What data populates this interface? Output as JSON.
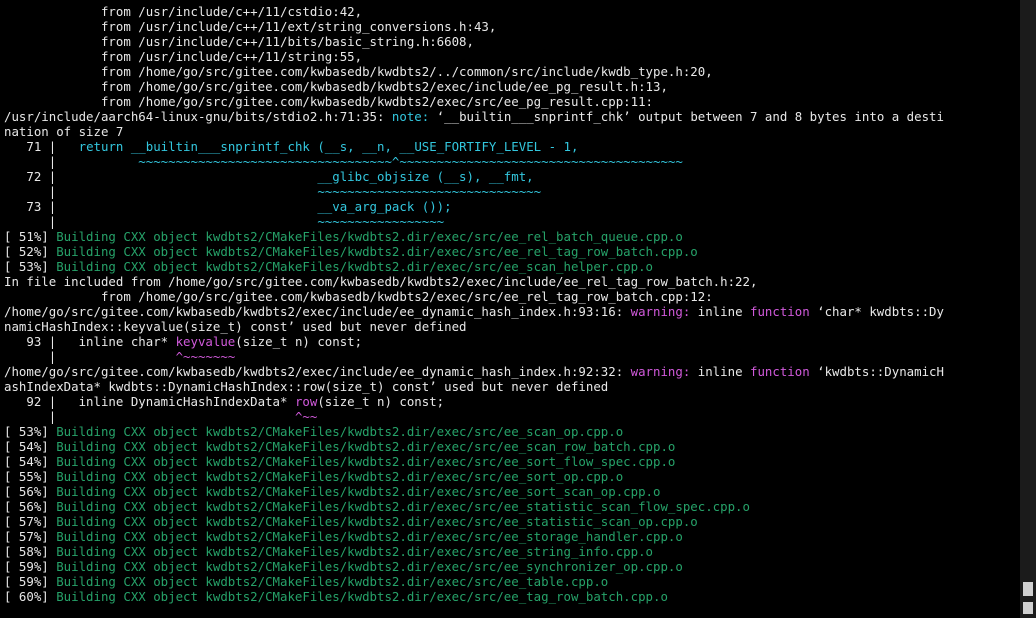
{
  "colors": {
    "green": "#26a269",
    "cyan": "#33c7de",
    "magenta": "#d15adb",
    "white": "#e8e8e8"
  },
  "lines": [
    [
      [
        "w",
        "             from /usr/include/c++/11/cstdio:42,"
      ]
    ],
    [
      [
        "w",
        "             from /usr/include/c++/11/ext/string_conversions.h:43,"
      ]
    ],
    [
      [
        "w",
        "             from /usr/include/c++/11/bits/basic_string.h:6608,"
      ]
    ],
    [
      [
        "w",
        "             from /usr/include/c++/11/string:55,"
      ]
    ],
    [
      [
        "w",
        "             from /home/go/src/gitee.com/kwbasedb/kwdbts2/../common/src/include/kwdb_type.h:20,"
      ]
    ],
    [
      [
        "w",
        "             from /home/go/src/gitee.com/kwbasedb/kwdbts2/exec/include/ee_pg_result.h:13,"
      ]
    ],
    [
      [
        "w",
        "             from /home/go/src/gitee.com/kwbasedb/kwdbts2/exec/src/ee_pg_result.cpp:11:"
      ]
    ],
    [
      [
        "w",
        "/usr/include/aarch64-linux-gnu/bits/stdio2.h:71:35: "
      ],
      [
        "c",
        "note: "
      ],
      [
        "w",
        "‘__builtin___snprintf_chk’ output between 7 and 8 bytes into a desti"
      ]
    ],
    [
      [
        "w",
        "nation of size 7"
      ]
    ],
    [
      [
        "w",
        "   71 |   "
      ],
      [
        "c",
        "return"
      ],
      [
        "w",
        " "
      ],
      [
        "c",
        "__builtin___snprintf_chk (__s, __n, __USE_FORTIFY_LEVEL - 1,"
      ]
    ],
    [
      [
        "w",
        "      |           "
      ],
      [
        "c",
        "~~~~~~~~~~~~~~~~~~~~~~~~~~~~~~~~~~^~~~~~~~~~~~~~~~~~~~~~~~~~~~~~~~~~~~~~~"
      ]
    ],
    [
      [
        "w",
        "   72 |                                   "
      ],
      [
        "c",
        "__glibc_objsize (__s), __fmt,"
      ]
    ],
    [
      [
        "w",
        "      |                                   "
      ],
      [
        "c",
        "~~~~~~~~~~~~~~~~~~~~~~~~~~~~~~"
      ]
    ],
    [
      [
        "w",
        "   73 |                                   "
      ],
      [
        "c",
        "__va_arg_pack ());"
      ]
    ],
    [
      [
        "w",
        "      |                                   "
      ],
      [
        "c",
        "~~~~~~~~~~~~~~~~~"
      ]
    ],
    [
      [
        "w",
        "[ 51%] "
      ],
      [
        "g",
        "Building CXX object kwdbts2/CMakeFiles/kwdbts2.dir/exec/src/ee_rel_batch_queue.cpp.o"
      ]
    ],
    [
      [
        "w",
        "[ 52%] "
      ],
      [
        "g",
        "Building CXX object kwdbts2/CMakeFiles/kwdbts2.dir/exec/src/ee_rel_tag_row_batch.cpp.o"
      ]
    ],
    [
      [
        "w",
        "[ 53%] "
      ],
      [
        "g",
        "Building CXX object kwdbts2/CMakeFiles/kwdbts2.dir/exec/src/ee_scan_helper.cpp.o"
      ]
    ],
    [
      [
        "w",
        "In file included from /home/go/src/gitee.com/kwbasedb/kwdbts2/exec/include/ee_rel_tag_row_batch.h:22,"
      ]
    ],
    [
      [
        "w",
        "             from /home/go/src/gitee.com/kwbasedb/kwdbts2/exec/src/ee_rel_tag_row_batch.cpp:12:"
      ]
    ],
    [
      [
        "w",
        "/home/go/src/gitee.com/kwbasedb/kwdbts2/exec/include/ee_dynamic_hash_index.h:93:16: "
      ],
      [
        "m",
        "warning: "
      ],
      [
        "w",
        "inline "
      ],
      [
        "m",
        "function"
      ],
      [
        "w",
        " ‘char* kwdbts::Dy"
      ]
    ],
    [
      [
        "w",
        "namicHashIndex::keyvalue(size_t) const’ used but never defined"
      ]
    ],
    [
      [
        "w",
        "   93 |   inline char* "
      ],
      [
        "m",
        "keyvalue"
      ],
      [
        "w",
        "(size_t n) const;"
      ]
    ],
    [
      [
        "w",
        "      |                "
      ],
      [
        "m",
        "^~~~~~~~"
      ]
    ],
    [
      [
        "w",
        "/home/go/src/gitee.com/kwbasedb/kwdbts2/exec/include/ee_dynamic_hash_index.h:92:32: "
      ],
      [
        "m",
        "warning: "
      ],
      [
        "w",
        "inline "
      ],
      [
        "m",
        "function"
      ],
      [
        "w",
        " ‘kwdbts::DynamicH"
      ]
    ],
    [
      [
        "w",
        "ashIndexData* kwdbts::DynamicHashIndex::row(size_t) const’ used but never defined"
      ]
    ],
    [
      [
        "w",
        "   92 |   inline DynamicHashIndexData* "
      ],
      [
        "m",
        "row"
      ],
      [
        "w",
        "(size_t n) const;"
      ]
    ],
    [
      [
        "w",
        "      |                                "
      ],
      [
        "m",
        "^~~"
      ]
    ],
    [
      [
        "w",
        "[ 53%] "
      ],
      [
        "g",
        "Building CXX object kwdbts2/CMakeFiles/kwdbts2.dir/exec/src/ee_scan_op.cpp.o"
      ]
    ],
    [
      [
        "w",
        "[ 54%] "
      ],
      [
        "g",
        "Building CXX object kwdbts2/CMakeFiles/kwdbts2.dir/exec/src/ee_scan_row_batch.cpp.o"
      ]
    ],
    [
      [
        "w",
        "[ 54%] "
      ],
      [
        "g",
        "Building CXX object kwdbts2/CMakeFiles/kwdbts2.dir/exec/src/ee_sort_flow_spec.cpp.o"
      ]
    ],
    [
      [
        "w",
        "[ 55%] "
      ],
      [
        "g",
        "Building CXX object kwdbts2/CMakeFiles/kwdbts2.dir/exec/src/ee_sort_op.cpp.o"
      ]
    ],
    [
      [
        "w",
        "[ 56%] "
      ],
      [
        "g",
        "Building CXX object kwdbts2/CMakeFiles/kwdbts2.dir/exec/src/ee_sort_scan_op.cpp.o"
      ]
    ],
    [
      [
        "w",
        "[ 56%] "
      ],
      [
        "g",
        "Building CXX object kwdbts2/CMakeFiles/kwdbts2.dir/exec/src/ee_statistic_scan_flow_spec.cpp.o"
      ]
    ],
    [
      [
        "w",
        "[ 57%] "
      ],
      [
        "g",
        "Building CXX object kwdbts2/CMakeFiles/kwdbts2.dir/exec/src/ee_statistic_scan_op.cpp.o"
      ]
    ],
    [
      [
        "w",
        "[ 57%] "
      ],
      [
        "g",
        "Building CXX object kwdbts2/CMakeFiles/kwdbts2.dir/exec/src/ee_storage_handler.cpp.o"
      ]
    ],
    [
      [
        "w",
        "[ 58%] "
      ],
      [
        "g",
        "Building CXX object kwdbts2/CMakeFiles/kwdbts2.dir/exec/src/ee_string_info.cpp.o"
      ]
    ],
    [
      [
        "w",
        "[ 59%] "
      ],
      [
        "g",
        "Building CXX object kwdbts2/CMakeFiles/kwdbts2.dir/exec/src/ee_synchronizer_op.cpp.o"
      ]
    ],
    [
      [
        "w",
        "[ 59%] "
      ],
      [
        "g",
        "Building CXX object kwdbts2/CMakeFiles/kwdbts2.dir/exec/src/ee_table.cpp.o"
      ]
    ],
    [
      [
        "w",
        "[ 60%] "
      ],
      [
        "g",
        "Building CXX object kwdbts2/CMakeFiles/kwdbts2.dir/exec/src/ee_tag_row_batch.cpp.o"
      ]
    ]
  ]
}
